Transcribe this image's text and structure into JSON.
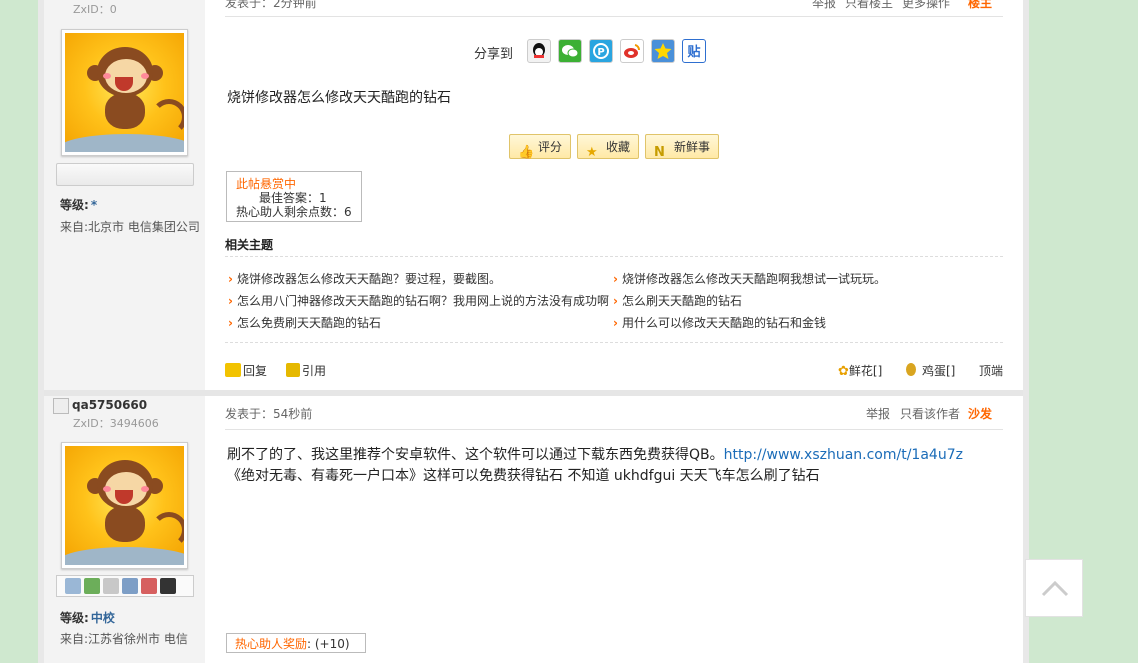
{
  "post1": {
    "zxid_label": "ZxID：",
    "zxid_value": "0",
    "level_label": "等级:",
    "level_value": "*",
    "from_text": "来自:北京市 电信集团公司",
    "time_text": "发表于：2分钟前",
    "actions": {
      "report": "举报",
      "only_author": "只看楼主",
      "more": "更多操作",
      "floor": "楼主"
    },
    "share_label": "分享到",
    "share_icons": [
      {
        "name": "qq-share-icon",
        "glyph": "Q",
        "color": "#e8e8e8"
      },
      {
        "name": "wechat-share-icon",
        "glyph": "微",
        "color": "#3cb034"
      },
      {
        "name": "qzone-share-icon",
        "glyph": "P",
        "color": "#2aa5e0"
      },
      {
        "name": "weibo-share-icon",
        "glyph": "微",
        "color": "#e0322b"
      },
      {
        "name": "favorite-share-icon",
        "glyph": "★",
        "color": "#4a90d9"
      },
      {
        "name": "tieba-share-icon",
        "glyph": "贴",
        "color": "#2e6fd0"
      }
    ],
    "content": "烧饼修改器怎么修改天天酷跑的钻石",
    "buttons": {
      "rate": "评分",
      "collect": "收藏",
      "fresh": "新鲜事"
    },
    "reward": {
      "title": "此帖悬赏中",
      "best": "最佳答案：1",
      "remaining": "热心助人剩余点数：6"
    },
    "related_title": "相关主题",
    "related": [
      "烧饼修改器怎么修改天天酷跑？要过程，要截图。",
      "烧饼修改器怎么修改天天酷跑啊我想试一试玩玩。",
      "怎么用八门神器修改天天酷跑的钻石啊？我用网上说的方法没有成功啊",
      "怎么刷天天酷跑的钻石",
      "怎么免费刷天天酷跑的钻石",
      "用什么可以修改天天酷跑的钻石和金钱"
    ],
    "reply": "回复",
    "quote": "引用",
    "flowers": "鲜花[]",
    "eggs": "鸡蛋[]",
    "top": "顶端"
  },
  "post2": {
    "username": "qa5750660",
    "zxid_label": "ZxID：",
    "zxid_value": "3494606",
    "level_label": "等级:",
    "level_value": "中校",
    "from_text": "来自:江苏省徐州市 电信",
    "time_text": "发表于：54秒前",
    "actions": {
      "report": "举报",
      "only_author": "只看该作者",
      "floor": "沙发"
    },
    "line1_text": "刷不了的了、我这里推荐个安卓软件、这个软件可以通过下载东西免费获得QB。",
    "line1_link": "http://www.xszhuan.com/t/1a4u7z",
    "line2_text": "《绝对无毒、有毒死一户口本》这样可以免费获得钻石 不知道 ukhdfgui 天天飞车怎么刷了钻石",
    "bonus_label": "热心助人奖励",
    "bonus_value": ": (+10)"
  },
  "colors": {
    "accent_orange": "#ff6600",
    "link_blue": "#1b6cb8",
    "page_bg": "#cfe8cf"
  }
}
